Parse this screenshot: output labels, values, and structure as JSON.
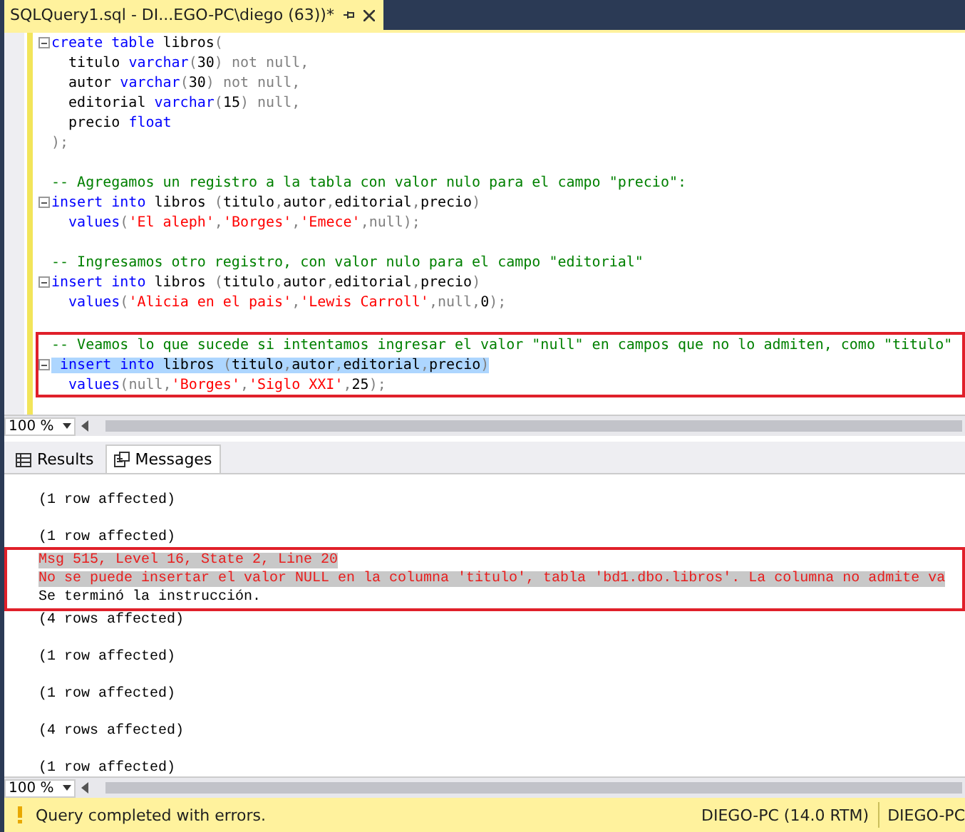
{
  "document_tab": {
    "title": "SQLQuery1.sql - DI...EGO-PC\\diego (63))*",
    "selected": true
  },
  "editor": {
    "blocks": [
      {
        "boxed": false,
        "lines": [
          {
            "kind": "code",
            "fold": true,
            "selected": false,
            "tokens": [
              {
                "text": "create table ",
                "kind": "kw"
              },
              {
                "text": "libros",
                "kind": "plain"
              },
              {
                "text": "(",
                "kind": "gray"
              }
            ]
          },
          {
            "kind": "code",
            "fold": false,
            "selected": false,
            "tokens": [
              {
                "text": "  titulo ",
                "kind": "plain"
              },
              {
                "text": "varchar",
                "kind": "kw"
              },
              {
                "text": "(",
                "kind": "gray"
              },
              {
                "text": "30",
                "kind": "plain"
              },
              {
                "text": ") not null,",
                "kind": "gray"
              }
            ]
          },
          {
            "kind": "code",
            "fold": false,
            "selected": false,
            "tokens": [
              {
                "text": "  autor ",
                "kind": "plain"
              },
              {
                "text": "varchar",
                "kind": "kw"
              },
              {
                "text": "(",
                "kind": "gray"
              },
              {
                "text": "30",
                "kind": "plain"
              },
              {
                "text": ") not null,",
                "kind": "gray"
              }
            ]
          },
          {
            "kind": "code",
            "fold": false,
            "selected": false,
            "tokens": [
              {
                "text": "  editorial ",
                "kind": "plain"
              },
              {
                "text": "varchar",
                "kind": "kw"
              },
              {
                "text": "(",
                "kind": "gray"
              },
              {
                "text": "15",
                "kind": "plain"
              },
              {
                "text": ") null,",
                "kind": "gray"
              }
            ]
          },
          {
            "kind": "code",
            "fold": false,
            "selected": false,
            "tokens": [
              {
                "text": "  precio ",
                "kind": "plain"
              },
              {
                "text": "float",
                "kind": "kw"
              }
            ]
          },
          {
            "kind": "code",
            "fold": false,
            "selected": false,
            "tokens": [
              {
                "text": ");",
                "kind": "gray"
              }
            ]
          },
          {
            "kind": "blank"
          },
          {
            "kind": "code",
            "fold": false,
            "selected": false,
            "tokens": [
              {
                "text": "-- Agregamos un registro a la tabla con valor nulo para el campo \"precio\":",
                "kind": "cmt"
              }
            ]
          },
          {
            "kind": "code",
            "fold": true,
            "selected": false,
            "tokens": [
              {
                "text": "insert into ",
                "kind": "kw"
              },
              {
                "text": "libros ",
                "kind": "plain"
              },
              {
                "text": "(",
                "kind": "gray"
              },
              {
                "text": "titulo",
                "kind": "plain"
              },
              {
                "text": ",",
                "kind": "gray"
              },
              {
                "text": "autor",
                "kind": "plain"
              },
              {
                "text": ",",
                "kind": "gray"
              },
              {
                "text": "editorial",
                "kind": "plain"
              },
              {
                "text": ",",
                "kind": "gray"
              },
              {
                "text": "precio",
                "kind": "plain"
              },
              {
                "text": ")",
                "kind": "gray"
              }
            ]
          },
          {
            "kind": "code",
            "fold": false,
            "selected": false,
            "tokens": [
              {
                "text": "  values",
                "kind": "kw"
              },
              {
                "text": "(",
                "kind": "gray"
              },
              {
                "text": "'El aleph'",
                "kind": "str"
              },
              {
                "text": ",",
                "kind": "gray"
              },
              {
                "text": "'Borges'",
                "kind": "str"
              },
              {
                "text": ",",
                "kind": "gray"
              },
              {
                "text": "'Emece'",
                "kind": "str"
              },
              {
                "text": ",null);",
                "kind": "gray"
              }
            ]
          },
          {
            "kind": "blank"
          },
          {
            "kind": "code",
            "fold": false,
            "selected": false,
            "tokens": [
              {
                "text": "-- Ingresamos otro registro, con valor nulo para el campo \"editorial\"",
                "kind": "cmt"
              }
            ]
          },
          {
            "kind": "code",
            "fold": true,
            "selected": false,
            "tokens": [
              {
                "text": "insert into ",
                "kind": "kw"
              },
              {
                "text": "libros ",
                "kind": "plain"
              },
              {
                "text": "(",
                "kind": "gray"
              },
              {
                "text": "titulo",
                "kind": "plain"
              },
              {
                "text": ",",
                "kind": "gray"
              },
              {
                "text": "autor",
                "kind": "plain"
              },
              {
                "text": ",",
                "kind": "gray"
              },
              {
                "text": "editorial",
                "kind": "plain"
              },
              {
                "text": ",",
                "kind": "gray"
              },
              {
                "text": "precio",
                "kind": "plain"
              },
              {
                "text": ")",
                "kind": "gray"
              }
            ]
          },
          {
            "kind": "code",
            "fold": false,
            "selected": false,
            "tokens": [
              {
                "text": "  values",
                "kind": "kw"
              },
              {
                "text": "(",
                "kind": "gray"
              },
              {
                "text": "'Alicia en el pais'",
                "kind": "str"
              },
              {
                "text": ",",
                "kind": "gray"
              },
              {
                "text": "'Lewis Carroll'",
                "kind": "str"
              },
              {
                "text": ",null,",
                "kind": "gray"
              },
              {
                "text": "0",
                "kind": "plain"
              },
              {
                "text": ");",
                "kind": "gray"
              }
            ]
          },
          {
            "kind": "blank"
          }
        ]
      },
      {
        "boxed": true,
        "lines": [
          {
            "kind": "code",
            "fold": false,
            "selected": false,
            "tokens": [
              {
                "text": "-- Veamos lo que sucede si intentamos ingresar el valor \"null\" en campos que no lo admiten, como \"titulo\"",
                "kind": "cmt"
              }
            ]
          },
          {
            "kind": "code",
            "fold": true,
            "selected": true,
            "tokens": [
              {
                "text": " insert into ",
                "kind": "kw"
              },
              {
                "text": "libros ",
                "kind": "plain"
              },
              {
                "text": "(",
                "kind": "gray"
              },
              {
                "text": "titulo",
                "kind": "plain"
              },
              {
                "text": ",",
                "kind": "gray"
              },
              {
                "text": "autor",
                "kind": "plain"
              },
              {
                "text": ",",
                "kind": "gray"
              },
              {
                "text": "editorial",
                "kind": "plain"
              },
              {
                "text": ",",
                "kind": "gray"
              },
              {
                "text": "precio",
                "kind": "plain"
              },
              {
                "text": ")",
                "kind": "gray"
              }
            ]
          },
          {
            "kind": "code",
            "fold": false,
            "selected": false,
            "tokens": [
              {
                "text": "  values",
                "kind": "kw"
              },
              {
                "text": "(null,",
                "kind": "gray"
              },
              {
                "text": "'Borges'",
                "kind": "str"
              },
              {
                "text": ",",
                "kind": "gray"
              },
              {
                "text": "'Siglo XXI'",
                "kind": "str"
              },
              {
                "text": ",",
                "kind": "gray"
              },
              {
                "text": "25",
                "kind": "plain"
              },
              {
                "text": ");",
                "kind": "gray"
              }
            ]
          }
        ]
      }
    ]
  },
  "editor_zoom": "100 %",
  "result_tabs": [
    {
      "label": "Results",
      "selected": false
    },
    {
      "label": "Messages",
      "selected": true
    }
  ],
  "messages": {
    "blocks": [
      {
        "boxed": false,
        "lines": [
          {
            "kind": "info",
            "selected": false,
            "text": "(1 row affected)"
          },
          {
            "kind": "blank"
          },
          {
            "kind": "info",
            "selected": false,
            "text": "(1 row affected)"
          }
        ]
      },
      {
        "boxed": true,
        "lines": [
          {
            "kind": "error",
            "selected": true,
            "text": "Msg 515, Level 16, State 2, Line 20"
          },
          {
            "kind": "error",
            "selected": true,
            "text": "No se puede insertar el valor NULL en la columna 'titulo', tabla 'bd1.dbo.libros'. La columna no admite va"
          },
          {
            "kind": "info",
            "selected": false,
            "text": "Se terminó la instrucción."
          }
        ]
      },
      {
        "boxed": false,
        "lines": [
          {
            "kind": "info",
            "selected": false,
            "text": "(4 rows affected)"
          },
          {
            "kind": "blank"
          },
          {
            "kind": "info",
            "selected": false,
            "text": "(1 row affected)"
          },
          {
            "kind": "blank"
          },
          {
            "kind": "info",
            "selected": false,
            "text": "(1 row affected)"
          },
          {
            "kind": "blank"
          },
          {
            "kind": "info",
            "selected": false,
            "text": "(4 rows affected)"
          },
          {
            "kind": "blank"
          },
          {
            "kind": "info",
            "selected": false,
            "text": "(1 row affected)"
          }
        ]
      }
    ]
  },
  "messages_zoom": "100 %",
  "status_bar": {
    "message": "Query completed with errors.",
    "server": "DIEGO-PC (14.0 RTM)",
    "user": "DIEGO-PC"
  }
}
